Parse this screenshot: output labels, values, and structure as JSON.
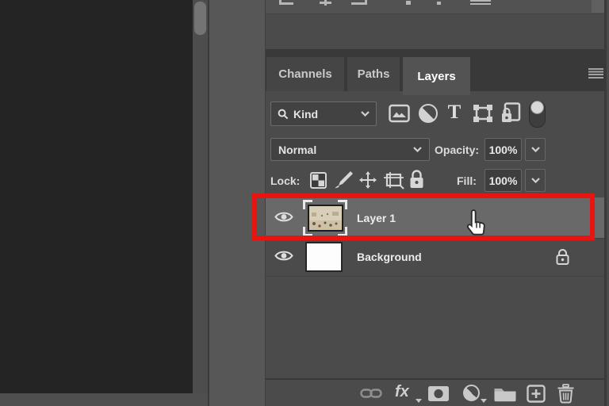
{
  "app": "photoshop-layers-panel",
  "colors": {
    "panel_bg": "#4b4b4b",
    "canvas_bg": "#242424",
    "selected_row": "#696969",
    "annotation_red": "#e8140f",
    "active_tab_bg": "#535353",
    "tabbar_bg": "#393939"
  },
  "tabs": {
    "channels": "Channels",
    "paths": "Paths",
    "layers": "Layers"
  },
  "filter": {
    "kind_label": "Kind",
    "icons": [
      "search-icon",
      "pixel-layer-filter-icon",
      "adjustment-layer-filter-icon",
      "type-layer-filter-icon",
      "shape-layer-filter-icon",
      "smart-object-filter-icon",
      "filter-toggle-switch"
    ],
    "type_glyph": "T"
  },
  "blend": {
    "mode": "Normal",
    "opacity_label": "Opacity:",
    "opacity_value": "100%"
  },
  "lock": {
    "label": "Lock:",
    "icons": [
      "lock-transparent-pixels-icon",
      "lock-image-pixels-icon",
      "lock-position-icon",
      "lock-artboard-icon",
      "lock-all-icon"
    ],
    "fill_label": "Fill:",
    "fill_value": "100%"
  },
  "layers": [
    {
      "name": "Layer 1",
      "selected": true,
      "visible": true,
      "thumbnail": "photo"
    },
    {
      "name": "Background",
      "selected": false,
      "visible": true,
      "locked": true,
      "thumbnail": "white"
    }
  ],
  "footer": {
    "fx_label": "fx",
    "icons": [
      "link-layers-icon",
      "layer-style-icon",
      "add-layer-mask-icon",
      "new-adjustment-layer-icon",
      "new-group-icon",
      "new-layer-icon",
      "delete-layer-icon"
    ]
  },
  "panel_menu": "panel-menu-icon"
}
